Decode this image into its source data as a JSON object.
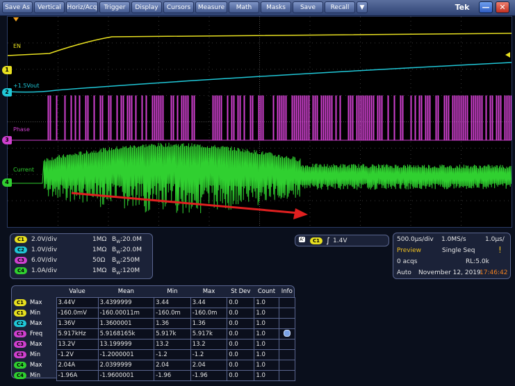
{
  "menu": {
    "items": [
      "Save As",
      "Vertical",
      "Horiz/Acq",
      "Trigger",
      "Display",
      "Cursors",
      "Measure",
      "Math",
      "Masks",
      "Save",
      "Recall"
    ],
    "dropdown_glyph": "▼",
    "brand": "Tek",
    "minimize_glyph": "—",
    "close_glyph": "✕"
  },
  "waveform_labels": {
    "ch1": "EN",
    "ch2": "+1.5Vout",
    "ch3": "Phase",
    "ch4": "Current"
  },
  "channel_markers": [
    "1",
    "2",
    "3",
    "4"
  ],
  "channel_colors": {
    "c1": "#e8e020",
    "c2": "#20c8d8",
    "c3": "#d040d0",
    "c4": "#30d030"
  },
  "vertical": [
    {
      "badge": "C1",
      "scale": "2.0V/div",
      "imp": "1MΩ",
      "bw_prefix": "B",
      "bw_sub": "W",
      "bw_val": ":20.0M"
    },
    {
      "badge": "C2",
      "scale": "1.0V/div",
      "imp": "1MΩ",
      "bw_prefix": "B",
      "bw_sub": "W",
      "bw_val": ":20.0M"
    },
    {
      "badge": "C3",
      "scale": "6.0V/div",
      "imp": "50Ω",
      "bw_prefix": "B",
      "bw_sub": "W",
      "bw_val": ":250M"
    },
    {
      "badge": "C4",
      "scale": "1.0A/div",
      "imp": "1MΩ",
      "bw_prefix": "B",
      "bw_sub": "W",
      "bw_val": ":120M"
    }
  ],
  "trigger": {
    "source_a": "A'",
    "badge": "C1",
    "level": "1.4V"
  },
  "horizontal": {
    "timebase": "500.0µs/div",
    "sample_rate": "1.0MS/s",
    "resolution": "1.0µs/",
    "mode": "Preview",
    "seq": "Single Seq",
    "acqs": "0 acqs",
    "record_length": "RL:5.0k",
    "run": "Auto",
    "date": "November 12, 2019",
    "time": "17:46:42"
  },
  "measurements": {
    "headers": [
      "",
      "",
      "Value",
      "Mean",
      "Min",
      "Max",
      "St Dev",
      "Count",
      "Info"
    ],
    "rows": [
      {
        "badge": "C1",
        "name": "Max",
        "value": "3.44V",
        "mean": "3.4399999",
        "min": "3.44",
        "max": "3.44",
        "stdev": "0.0",
        "count": "1.0",
        "info": ""
      },
      {
        "badge": "C1",
        "name": "Min",
        "value": "-160.0mV",
        "mean": "-160.00011m",
        "min": "-160.0m",
        "max": "-160.0m",
        "stdev": "0.0",
        "count": "1.0",
        "info": ""
      },
      {
        "badge": "C2",
        "name": "Max",
        "value": "1.36V",
        "mean": "1.3600001",
        "min": "1.36",
        "max": "1.36",
        "stdev": "0.0",
        "count": "1.0",
        "info": ""
      },
      {
        "badge": "C3",
        "name": "Freq",
        "value": "5.917kHz",
        "mean": "5.9168165k",
        "min": "5.917k",
        "max": "5.917k",
        "stdev": "0.0",
        "count": "1.0",
        "info": "dot"
      },
      {
        "badge": "C3",
        "name": "Max",
        "value": "13.2V",
        "mean": "13.199999",
        "min": "13.2",
        "max": "13.2",
        "stdev": "0.0",
        "count": "1.0",
        "info": ""
      },
      {
        "badge": "C3",
        "name": "Min",
        "value": "-1.2V",
        "mean": "-1.2000001",
        "min": "-1.2",
        "max": "-1.2",
        "stdev": "0.0",
        "count": "1.0",
        "info": ""
      },
      {
        "badge": "C4",
        "name": "Max",
        "value": "2.04A",
        "mean": "2.0399999",
        "min": "2.04",
        "max": "2.04",
        "stdev": "0.0",
        "count": "1.0",
        "info": ""
      },
      {
        "badge": "C4",
        "name": "Min",
        "value": "-1.96A",
        "mean": "-1.9600001",
        "min": "-1.96",
        "max": "-1.96",
        "stdev": "0.0",
        "count": "1.0",
        "info": ""
      }
    ]
  }
}
